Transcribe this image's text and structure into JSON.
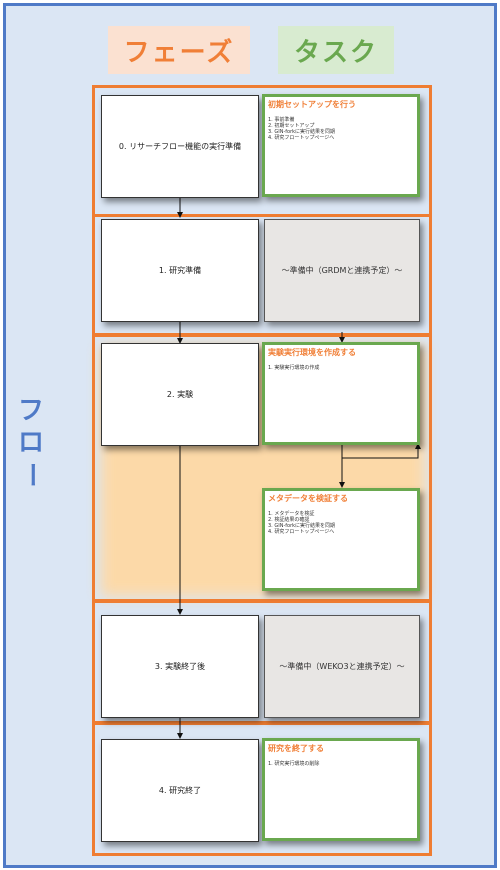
{
  "headers": {
    "phase": "フェーズ",
    "task": "タスク"
  },
  "flow_label": "フロー",
  "phases": [
    {
      "label": "0. リサーチフロー機能の実行準備"
    },
    {
      "label": "1. 研究準備"
    },
    {
      "label": "2. 実験"
    },
    {
      "label": "3. 実験終了後"
    },
    {
      "label": "4. 研究終了"
    }
  ],
  "tasks": [
    {
      "title": "初期セットアップを行う",
      "items": [
        "1. 事前準備",
        "2. 初期セットアップ",
        "3. GIN-forkに実行結果を同期",
        "4. 研究フロートップページへ"
      ]
    },
    {
      "title": "実験実行環境を作成する",
      "items": [
        "1. 実験実行環境の作成"
      ]
    },
    {
      "title": "メタデータを検証する",
      "items": [
        "1. メタデータを検証",
        "2. 検証結果の確認",
        "3. GIN-forkに実行結果を同期",
        "4. 研究フロートップページへ"
      ]
    },
    {
      "title": "研究を終了する",
      "items": [
        "1. 研究実行環境の削除"
      ]
    }
  ],
  "pending": [
    {
      "label": "～準備中（GRDMと連携予定）～"
    },
    {
      "label": "～準備中（WEKO3と連携予定）～"
    }
  ]
}
